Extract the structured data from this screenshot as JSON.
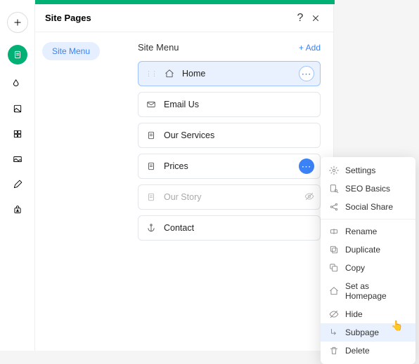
{
  "header": {
    "title": "Site Pages"
  },
  "sidebar": {
    "chip": "Site Menu"
  },
  "menu": {
    "title": "Site Menu",
    "add": "+ Add",
    "items": [
      {
        "label": "Home"
      },
      {
        "label": "Email Us"
      },
      {
        "label": "Our Services"
      },
      {
        "label": "Prices"
      },
      {
        "label": "Our Story"
      },
      {
        "label": "Contact"
      }
    ]
  },
  "context": {
    "settings": "Settings",
    "seo": "SEO Basics",
    "social": "Social Share",
    "rename": "Rename",
    "duplicate": "Duplicate",
    "copy": "Copy",
    "homepage": "Set as Homepage",
    "hide": "Hide",
    "subpage": "Subpage",
    "delete": "Delete"
  }
}
